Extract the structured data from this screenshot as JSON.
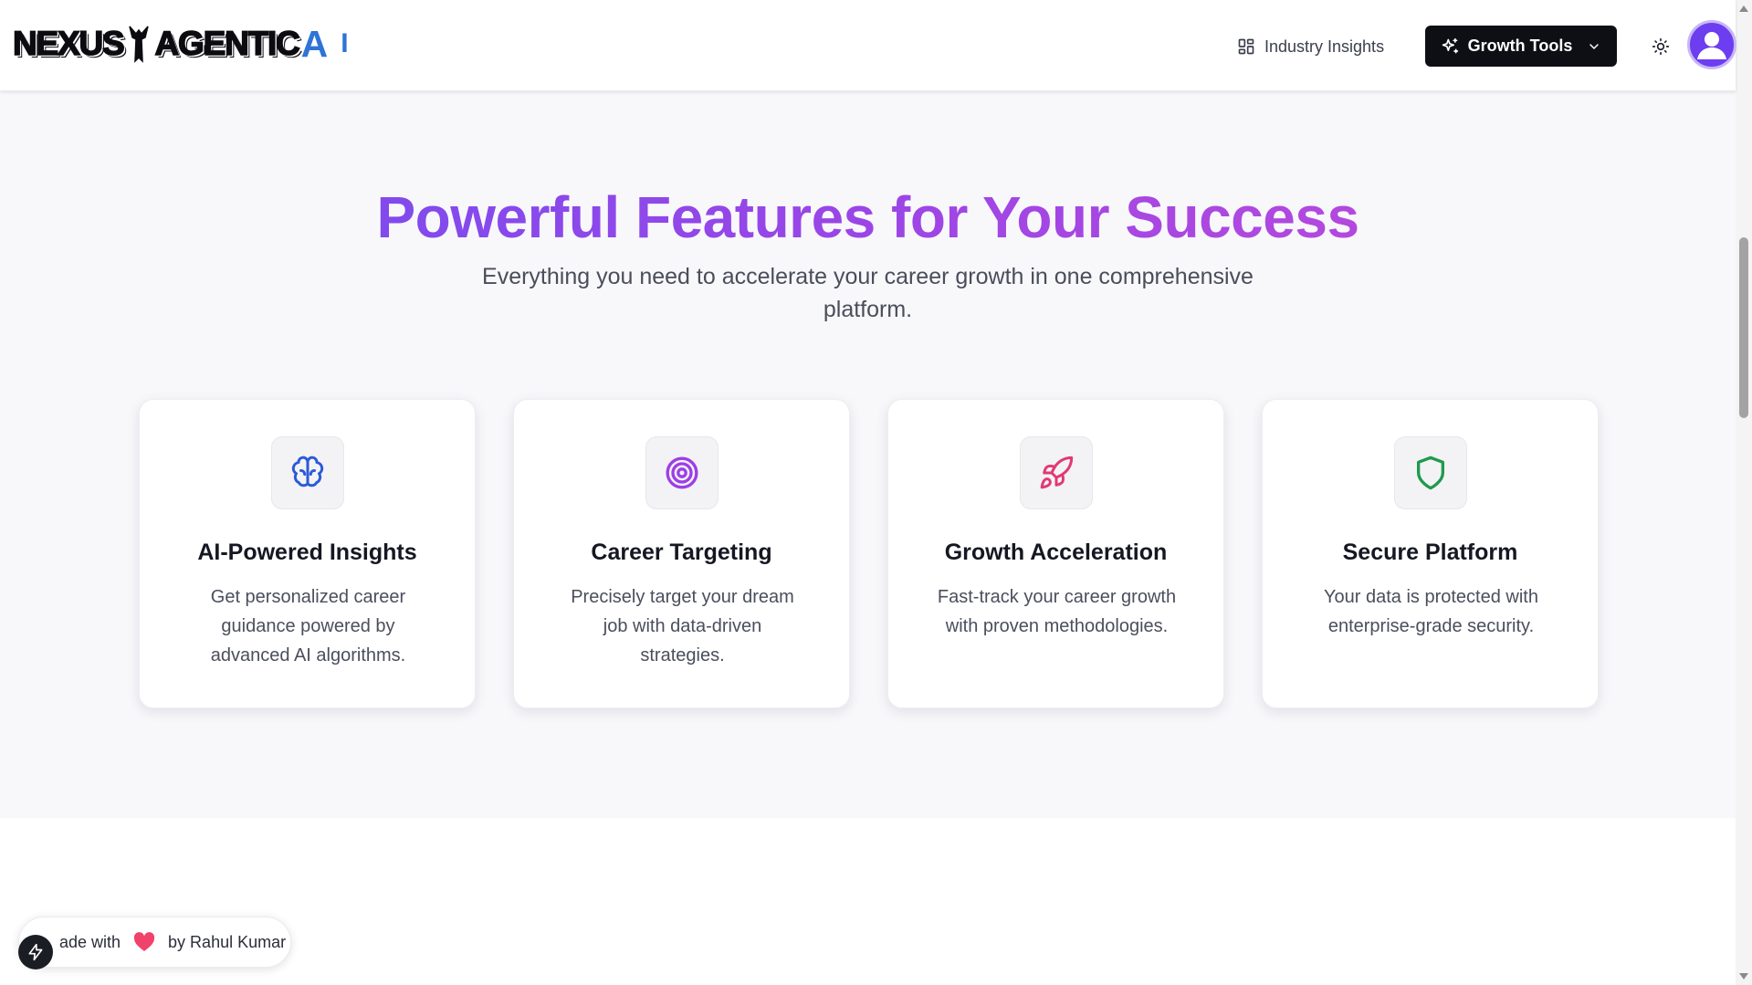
{
  "header": {
    "logo": {
      "text": "NEXUS",
      "text_2": "AGENTIC",
      "ai": "A",
      "ai_2": "I"
    },
    "nav_insights_label": "Industry Insights",
    "growth_tools_label": "Growth Tools"
  },
  "features": {
    "title": "Powerful Features for Your Success",
    "subtitle": "Everything you need to accelerate your career growth in one comprehensive platform.",
    "cards": [
      {
        "icon": "brain-icon",
        "title": "AI-Powered Insights",
        "description": "Get personalized career guidance powered by advanced AI algorithms.",
        "color": "#2a5bd7"
      },
      {
        "icon": "target-icon",
        "title": "Career Targeting",
        "description": "Precisely target your dream job with data-driven strategies.",
        "color": "#9d3ee6"
      },
      {
        "icon": "rocket-icon",
        "title": "Growth Acceleration",
        "description": "Fast-track your career growth with proven methodologies.",
        "color": "#e13a73"
      },
      {
        "icon": "shield-icon",
        "title": "Secure Platform",
        "description": "Your data is protected with enterprise-grade security.",
        "color": "#1f9a4e"
      }
    ]
  },
  "badge": {
    "made_with": "ade with",
    "by": "by Rahul Kumar"
  },
  "colors": {
    "accent_start": "#6d4ff2",
    "accent_end": "#c64bd8",
    "button_dark": "#0d0f14",
    "heart": "#f0426a"
  }
}
